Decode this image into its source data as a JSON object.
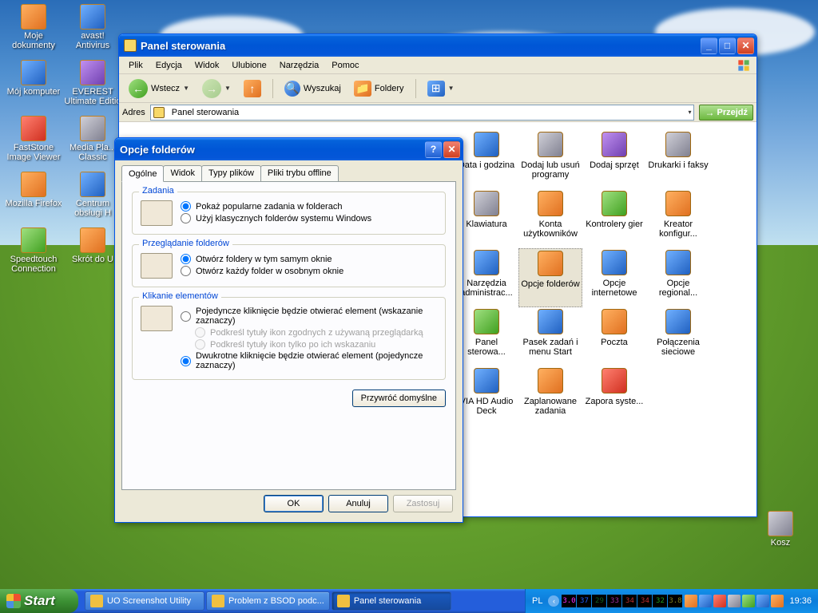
{
  "desktop": {
    "icons_col1": [
      {
        "label": "Moje dokumenty"
      },
      {
        "label": "Mój komputer"
      },
      {
        "label": "FastStone Image Viewer"
      },
      {
        "label": "Mozilla Firefox"
      },
      {
        "label": "Speedtouch Connection"
      }
    ],
    "icons_col2": [
      {
        "label": "avast! Antivirus"
      },
      {
        "label": "EVEREST Ultimate Editio"
      },
      {
        "label": "Media Pla... Classic"
      },
      {
        "label": "Centrum obsługi H"
      },
      {
        "label": "Skrót do U"
      }
    ],
    "recycle": "Kosz"
  },
  "explorer": {
    "title": "Panel sterowania",
    "menu": [
      "Plik",
      "Edycja",
      "Widok",
      "Ulubione",
      "Narzędzia",
      "Pomoc"
    ],
    "toolbar": {
      "back": "Wstecz",
      "search": "Wyszukaj",
      "folders": "Foldery"
    },
    "address_label": "Adres",
    "address_value": "Panel sterowania",
    "go": "Przejdź",
    "icons": [
      {
        "label": "Data i godzina"
      },
      {
        "label": "Dodaj lub usuń programy"
      },
      {
        "label": "Dodaj sprzęt"
      },
      {
        "label": "Drukarki i faksy"
      },
      {
        "label": "Klawiatura"
      },
      {
        "label": "Konta użytkowników"
      },
      {
        "label": "Kontrolery gier"
      },
      {
        "label": "Kreator konfigur..."
      },
      {
        "label": "Narzędzia administrac..."
      },
      {
        "label": "Opcje folderów",
        "selected": true
      },
      {
        "label": "Opcje internetowe"
      },
      {
        "label": "Opcje regional..."
      },
      {
        "label": "Panel sterowa..."
      },
      {
        "label": "Pasek zadań i menu Start"
      },
      {
        "label": "Poczta"
      },
      {
        "label": "Połączenia sieciowe"
      },
      {
        "label": "VIA HD Audio Deck"
      },
      {
        "label": "Zaplanowane zadania"
      },
      {
        "label": "Zapora syste..."
      }
    ]
  },
  "dialog": {
    "title": "Opcje folderów",
    "tabs": [
      "Ogólne",
      "Widok",
      "Typy plików",
      "Pliki trybu offline"
    ],
    "active_tab": 0,
    "tasks": {
      "title": "Zadania",
      "opt1": "Pokaż popularne zadania w folderach",
      "opt2": "Użyj klasycznych folderów systemu Windows"
    },
    "browse": {
      "title": "Przeglądanie folderów",
      "opt1": "Otwórz foldery w tym samym oknie",
      "opt2": "Otwórz każdy folder w osobnym oknie"
    },
    "click": {
      "title": "Klikanie elementów",
      "opt1": "Pojedyncze kliknięcie będzie otwierać element (wskazanie zaznaczy)",
      "sub1": "Podkreśl tytuły ikon zgodnych z używaną przeglądarką",
      "sub2": "Podkreśl tytuły ikon tylko po ich wskazaniu",
      "opt2": "Dwukrotne kliknięcie będzie otwierać element (pojedyncze zaznaczy)"
    },
    "restore": "Przywróć domyślne",
    "ok": "OK",
    "cancel": "Anuluj",
    "apply": "Zastosuj"
  },
  "taskbar": {
    "start": "Start",
    "tasks": [
      {
        "label": "UO Screenshot Utility"
      },
      {
        "label": "Problem z BSOD podc..."
      },
      {
        "label": "Panel sterowania",
        "active": true
      }
    ],
    "lang": "PL",
    "meters": [
      "3.0",
      "37",
      "29",
      "33",
      "34",
      "34",
      "32",
      "3.8"
    ],
    "meter_colors": [
      "#ff30ff",
      "#2060ff",
      "#106020",
      "#a030a0",
      "#c03030",
      "#c03030",
      "#20a020",
      "#808020"
    ],
    "clock": "19:36"
  }
}
